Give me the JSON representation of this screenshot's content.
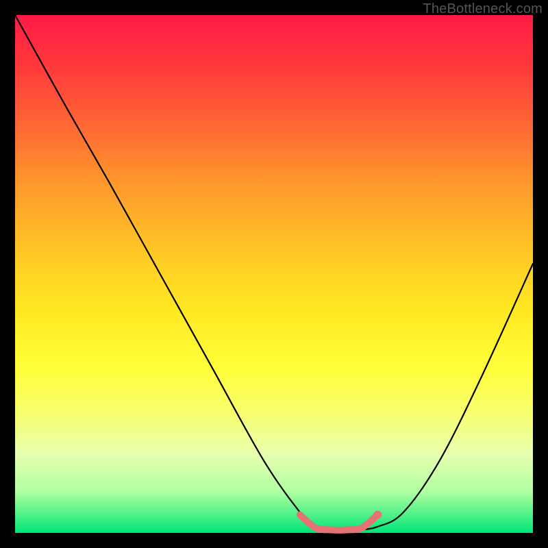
{
  "watermark": "TheBottleneck.com",
  "colors": {
    "background": "#000000",
    "curve_stroke": "#000000",
    "highlight_stroke": "#e57373",
    "highlight_fill": "#e57373"
  },
  "chart_data": {
    "type": "line",
    "title": "",
    "xlabel": "",
    "ylabel": "",
    "xlim": [
      0,
      100
    ],
    "ylim": [
      0,
      100
    ],
    "series": [
      {
        "name": "v-curve",
        "x": [
          0,
          10,
          18,
          28,
          38,
          48,
          55,
          58,
          62,
          66,
          70,
          75,
          82,
          90,
          100
        ],
        "y": [
          100,
          82,
          68,
          50,
          32,
          14,
          4,
          1.2,
          0.6,
          0.6,
          1.2,
          4,
          14,
          30,
          52
        ]
      },
      {
        "name": "highlight-flat-bottom",
        "x": [
          55,
          58,
          61,
          64,
          67,
          70
        ],
        "y": [
          3.5,
          1.0,
          0.6,
          0.6,
          1.0,
          3.5
        ]
      }
    ],
    "annotations": []
  }
}
